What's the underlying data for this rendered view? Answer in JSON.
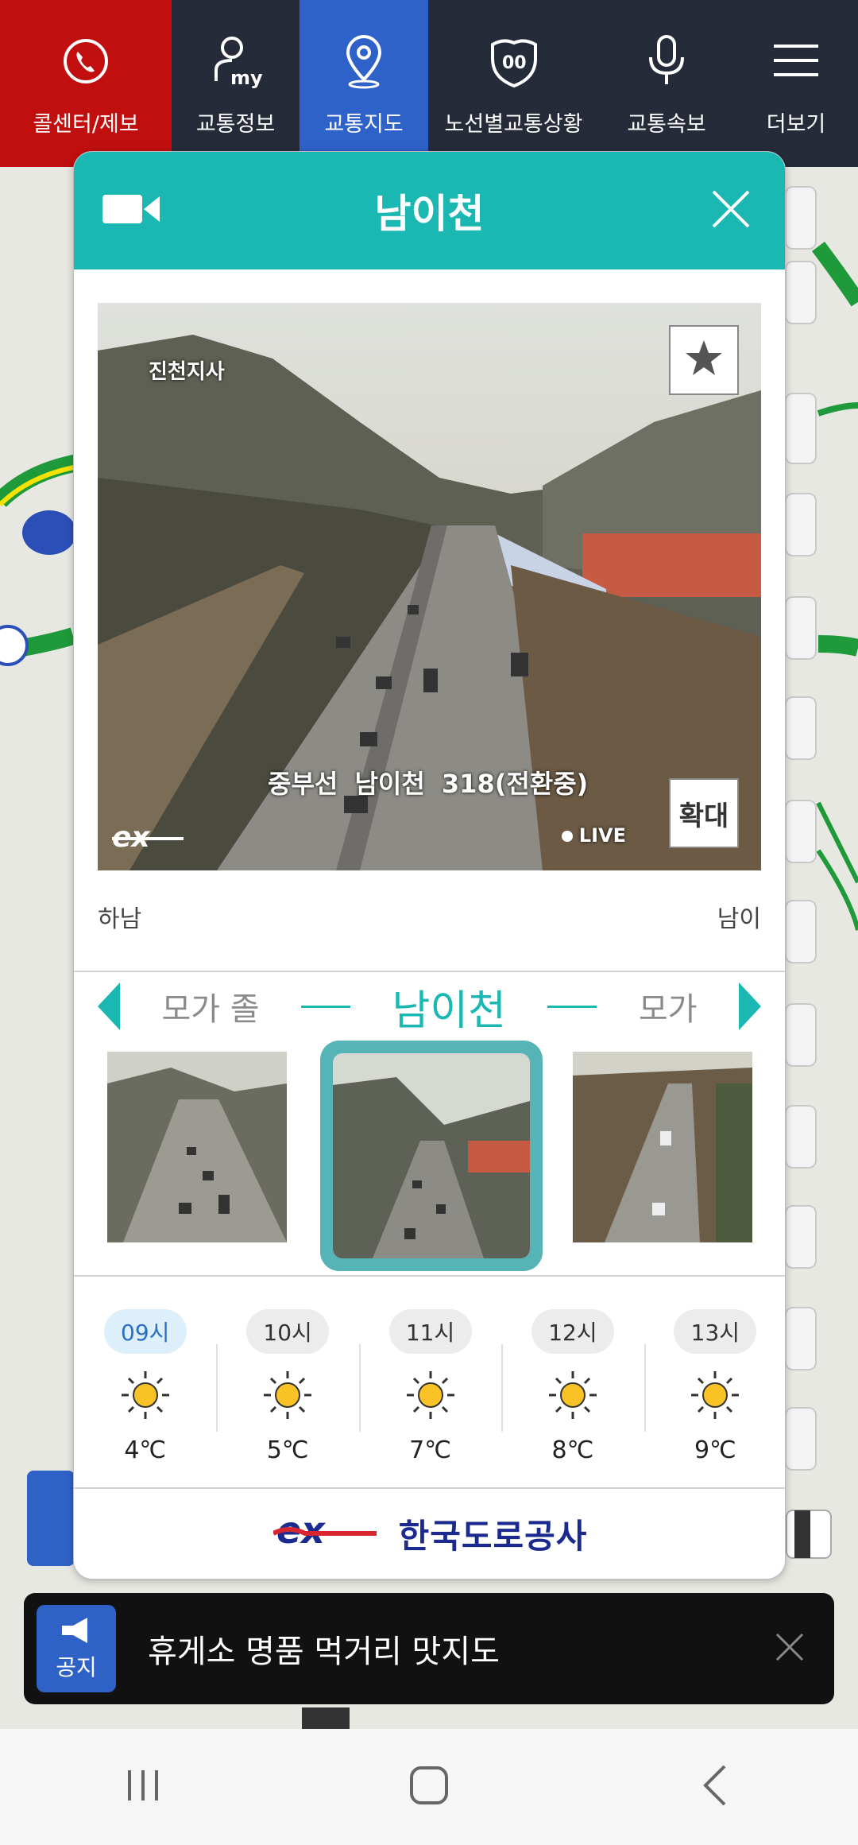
{
  "topnav": {
    "items": [
      {
        "label": "콜센터/제보",
        "icon": "phone-icon"
      },
      {
        "label": "교통정보",
        "icon": "my-user-icon"
      },
      {
        "label": "교통지도",
        "icon": "map-pin-icon"
      },
      {
        "label": "노선별교통상황",
        "icon": "route-shield-icon"
      },
      {
        "label": "교통속보",
        "icon": "microphone-icon"
      },
      {
        "label": "더보기",
        "icon": "menu-icon"
      }
    ],
    "active": "교통지도"
  },
  "popup": {
    "title": "남이천",
    "video": {
      "station_text": "진천지사",
      "caption": "중부선  남이천  318(전환중)",
      "live_label": "LIVE",
      "zoom_label": "확대"
    },
    "direction_left": "하남",
    "direction_right": "남이",
    "camera_nav": {
      "prev": "모가 졸",
      "current": "남이천",
      "next": "모가"
    },
    "weather": [
      {
        "hour": "09시",
        "temp": "4℃",
        "active": true
      },
      {
        "hour": "10시",
        "temp": "5℃"
      },
      {
        "hour": "11시",
        "temp": "7℃"
      },
      {
        "hour": "12시",
        "temp": "8℃"
      },
      {
        "hour": "13시",
        "temp": "9℃"
      }
    ],
    "footer_brand": "한국도로공사"
  },
  "notice": {
    "badge": "공지",
    "text": "휴게소 명품 먹거리 맛지도"
  },
  "colors": {
    "accent": "#1bb8b3",
    "call_red": "#c10f0f",
    "nav_bg": "#262b3a",
    "nav_active": "#2e62c9"
  }
}
